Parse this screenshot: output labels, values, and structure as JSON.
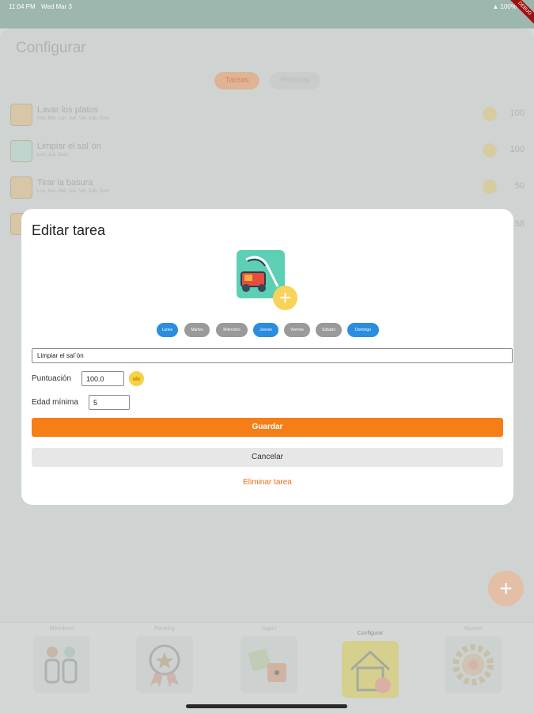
{
  "status": {
    "time": "11:04 PM",
    "date": "Wed Mar 3",
    "battery": "100%",
    "debug": "DEBUG"
  },
  "header": {
    "title": "Configurar"
  },
  "segments": {
    "tasks": "Tareas",
    "rewards": "Premios"
  },
  "tasks": [
    {
      "name": "Lavar los platos",
      "days": "Mar, Mié, Lun, Jue, Vie, Sáb, Dom",
      "points": "100"
    },
    {
      "name": "Limpiar el sal´ón",
      "days": "Lun, Jue, Dom",
      "points": "100"
    },
    {
      "name": "Tirar la basura",
      "days": "Lun, Mar, Mié, Jue, Vie, Sáb, Dom",
      "points": "50"
    },
    {
      "name": "",
      "days": "",
      "points": "58"
    }
  ],
  "tabs": {
    "members": "Miembros",
    "ranking": "Ranking",
    "play": "Jugar!",
    "configure": "Configurar",
    "settings": "Ajustes"
  },
  "dialog": {
    "title": "Editar tarea",
    "days": [
      {
        "label": "Lunes",
        "selected": true
      },
      {
        "label": "Martes",
        "selected": false
      },
      {
        "label": "Miércoles",
        "selected": false
      },
      {
        "label": "Jueves",
        "selected": true
      },
      {
        "label": "Viernes",
        "selected": false
      },
      {
        "label": "Sábado",
        "selected": false
      },
      {
        "label": "Domingo",
        "selected": true
      }
    ],
    "task_name_value": "Limpiar el sal´ón",
    "points_label": "Puntuación",
    "points_value": "100.0",
    "min_age_label": "Edad mínima",
    "min_age_value": "5",
    "save_label": "Guardar",
    "cancel_label": "Cancelar",
    "delete_label": "Eliminar tarea"
  },
  "colors": {
    "accent": "#f77d17",
    "day_selected": "#2a8de0",
    "day_unselected": "#9a9a9a",
    "coin": "#f4d24b"
  }
}
